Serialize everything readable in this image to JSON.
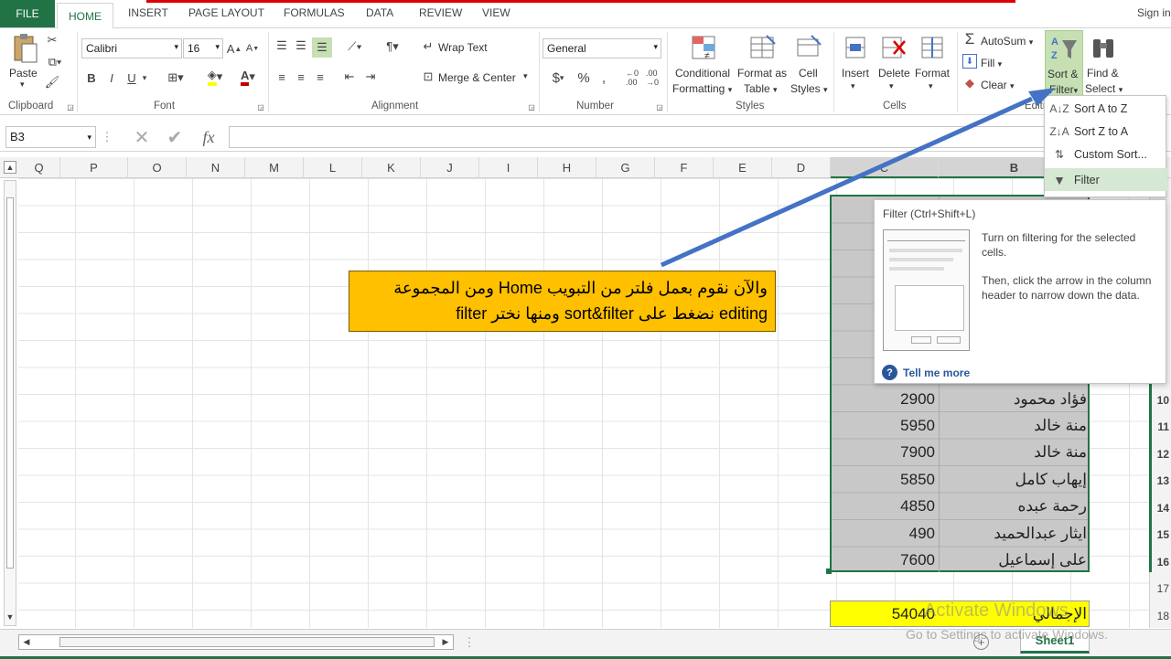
{
  "tabs": {
    "file": "FILE",
    "home": "HOME",
    "insert": "INSERT",
    "page_layout": "PAGE LAYOUT",
    "formulas": "FORMULAS",
    "data": "DATA",
    "review": "REVIEW",
    "view": "VIEW",
    "sign_in": "Sign in"
  },
  "ribbon": {
    "clipboard": {
      "paste": "Paste",
      "label": "Clipboard"
    },
    "font": {
      "name": "Calibri",
      "size": "16",
      "bold": "B",
      "italic": "I",
      "underline": "U",
      "label": "Font"
    },
    "alignment": {
      "wrap_text": "Wrap Text",
      "merge_center": "Merge & Center",
      "label": "Alignment"
    },
    "number": {
      "format": "General",
      "currency": "$",
      "percent": "%",
      "comma": ",",
      "label": "Number"
    },
    "styles": {
      "conditional_1": "Conditional",
      "conditional_2": "Formatting",
      "format_as_1": "Format as",
      "format_as_2": "Table",
      "cell_styles_1": "Cell",
      "cell_styles_2": "Styles",
      "label": "Styles"
    },
    "cells": {
      "insert": "Insert",
      "delete": "Delete",
      "format": "Format",
      "label": "Cells"
    },
    "editing": {
      "autosum": "AutoSum",
      "fill": "Fill",
      "clear": "Clear",
      "sort_filter_1": "Sort &",
      "sort_filter_2": "Filter",
      "find_select_1": "Find &",
      "find_select_2": "Select",
      "label": "Editi"
    }
  },
  "sort_menu": {
    "items": [
      "Sort A to Z",
      "Sort Z to A",
      "Custom Sort...",
      "Filter"
    ]
  },
  "tooltip": {
    "title": "Filter (Ctrl+Shift+L)",
    "line1": "Turn on filtering for the selected cells.",
    "line2": "Then, click the arrow in the column header to narrow down the data.",
    "more": "Tell me more"
  },
  "formula_bar": {
    "name_box": "B3",
    "fx": "fx"
  },
  "columns": [
    "Q",
    "P",
    "O",
    "N",
    "M",
    "L",
    "K",
    "J",
    "I",
    "H",
    "G",
    "F",
    "E",
    "D",
    "C",
    "B"
  ],
  "rows": [
    {
      "n": "10",
      "amount": "2900",
      "name": "فؤاد محمود"
    },
    {
      "n": "11",
      "amount": "5950",
      "name": "منة خالد"
    },
    {
      "n": "12",
      "amount": "7900",
      "name": "منة خالد"
    },
    {
      "n": "13",
      "amount": "5850",
      "name": "إيهاب كامل"
    },
    {
      "n": "14",
      "amount": "4850",
      "name": "رحمة عبده"
    },
    {
      "n": "15",
      "amount": "490",
      "name": "ايثار عبدالحميد"
    },
    {
      "n": "16",
      "amount": "7600",
      "name": "على إسماعيل"
    },
    {
      "n": "17",
      "amount": "",
      "name": ""
    },
    {
      "n": "18",
      "amount": "54040",
      "name": "الإجمالي"
    }
  ],
  "callout": {
    "line1": "والآن نقوم بعمل فلتر من التبويب Home ومن المجموعة",
    "line2": "editing نضغط على sort&filter ومنها نختر filter"
  },
  "watermark": {
    "line1": "Activate Windows",
    "line2": "Go to Settings to activate Windows."
  },
  "sheet": {
    "name": "Sheet1"
  },
  "colors": {
    "excel_green": "#217346",
    "selection": "#c8c8c8",
    "callout": "#ffc000",
    "total": "#ffff00",
    "arrow": "#4472c4"
  }
}
